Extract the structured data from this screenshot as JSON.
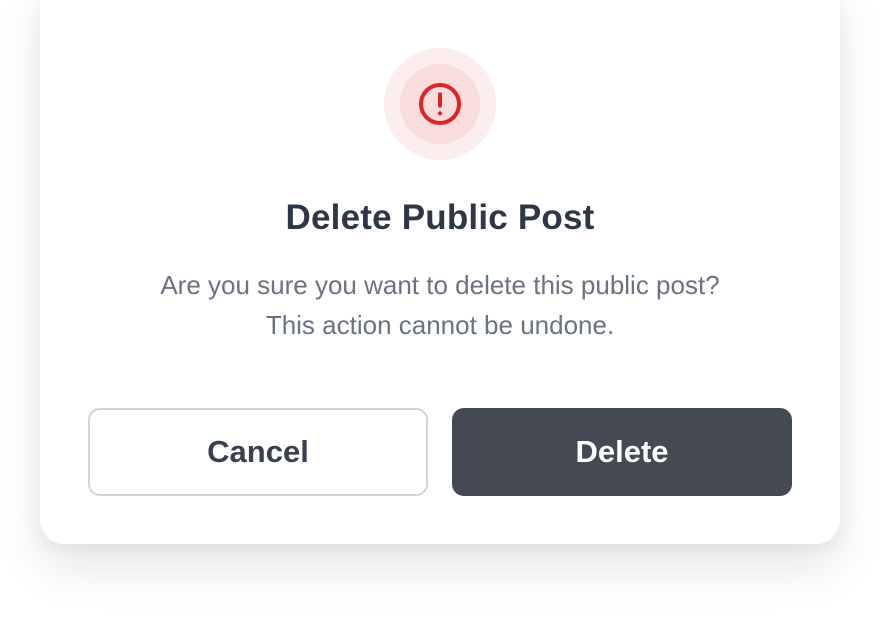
{
  "dialog": {
    "icon": "alert-circle-icon",
    "title": "Delete Public Post",
    "message_lines": [
      "Are you sure you want to delete this public post?",
      "This action cannot be undone."
    ],
    "cancel_label": "Cancel",
    "delete_label": "Delete"
  },
  "colors": {
    "icon_stroke": "#dc2626",
    "icon_bg": "#fbdcdc",
    "icon_halo": "#fdeeee",
    "title": "#2d3748",
    "message": "#6b7280",
    "delete_bg": "#454954",
    "cancel_border": "#d1d5db"
  }
}
